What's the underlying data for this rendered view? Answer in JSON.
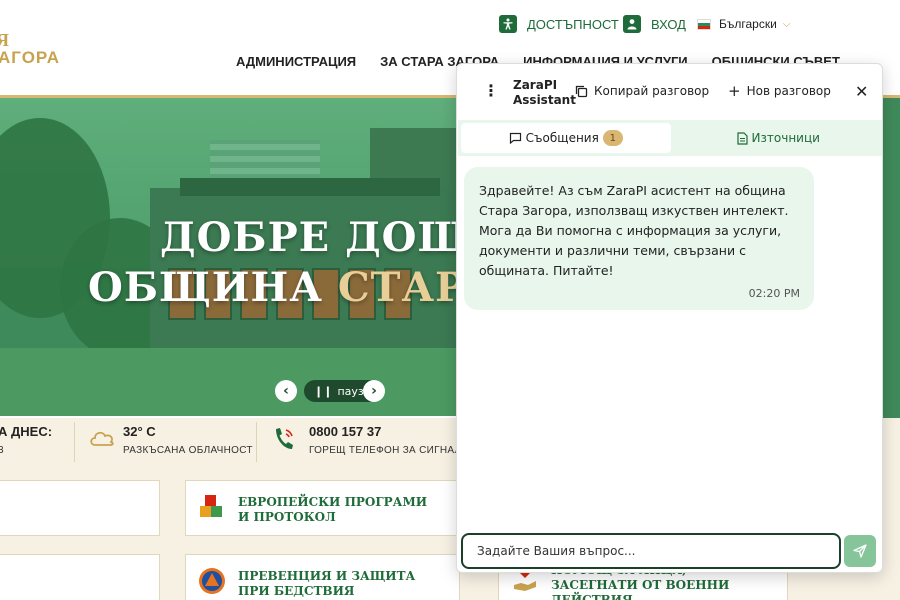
{
  "site": {
    "logo_line1": "Я",
    "logo_line2": "АГОРА"
  },
  "utility": {
    "accessibility": "ДОСТЪПНОСТ",
    "login": "ВХОД",
    "language": "Български"
  },
  "nav": {
    "items": [
      {
        "label": "АДМИНИСТРАЦИЯ"
      },
      {
        "label": "ЗА СТАРА ЗАГОРА"
      },
      {
        "label": "ИНФОРМАЦИЯ И УСЛУГИ"
      },
      {
        "label": "ОБЩИНСКИ СЪВЕТ"
      }
    ]
  },
  "hero": {
    "line1": "ДОБРЕ ДОШЛИ",
    "line2_white": "ОБЩИНА ",
    "line2_gold": "СТАРА ЗА",
    "pause_label": "пауза"
  },
  "info": {
    "today_label": "А ДНЕС:",
    "today_sub": "3",
    "weather_value": "32° C",
    "weather_desc": "РАЗКЪСАНА ОБЛАЧНОСТ",
    "hotline_value": "0800 157 37",
    "hotline_desc": "ГОРЕЩ ТЕЛЕФОН ЗА СИГНАЛИ"
  },
  "cards": [
    {
      "title": "ЕВРОПЕЙСКИ ПРОГРАМИ И ПРОТОКОЛ"
    },
    {
      "title": "ПРЕВЕНЦИЯ И ЗАЩИТА ПРИ БЕДСТВИЯ"
    },
    {
      "title": "ПОМОЩ ЗА ЛИЦА, ЗАСЕГНАТИ ОТ ВОЕННИ ДЕЙСТВИЯ"
    }
  ],
  "chat": {
    "assistant_name": "ZaraPI Assistant",
    "copy_label": "Копирай разговор",
    "new_label": "Нов разговор",
    "tab_messages": "Съобщения",
    "tab_messages_count": "1",
    "tab_sources": "Източници",
    "message_text": "Здравейте! Аз съм ZaraPI асистент на община Стара Загора, използващ изкуствен интелект. Мога да Ви помогна с информация за услуги, документи и различни теми, свързани с общината. Питайте!",
    "message_time": "02:20 PM",
    "input_placeholder": "Задайте Вашия въпрос..."
  },
  "colors": {
    "brand_green": "#1f6b3a",
    "gold": "#d9b671",
    "chat_bubble": "#e8f6ec",
    "send_button": "#86c59a"
  },
  "icons": {
    "accessibility": "accessibility-icon",
    "login": "user-icon",
    "weather": "cloud-icon",
    "hotline": "phone-icon",
    "kebab": "kebab-menu-icon",
    "copy": "copy-icon",
    "new": "plus-icon",
    "close": "close-icon",
    "messages": "chat-icon",
    "sources": "document-icon",
    "send": "send-icon"
  }
}
